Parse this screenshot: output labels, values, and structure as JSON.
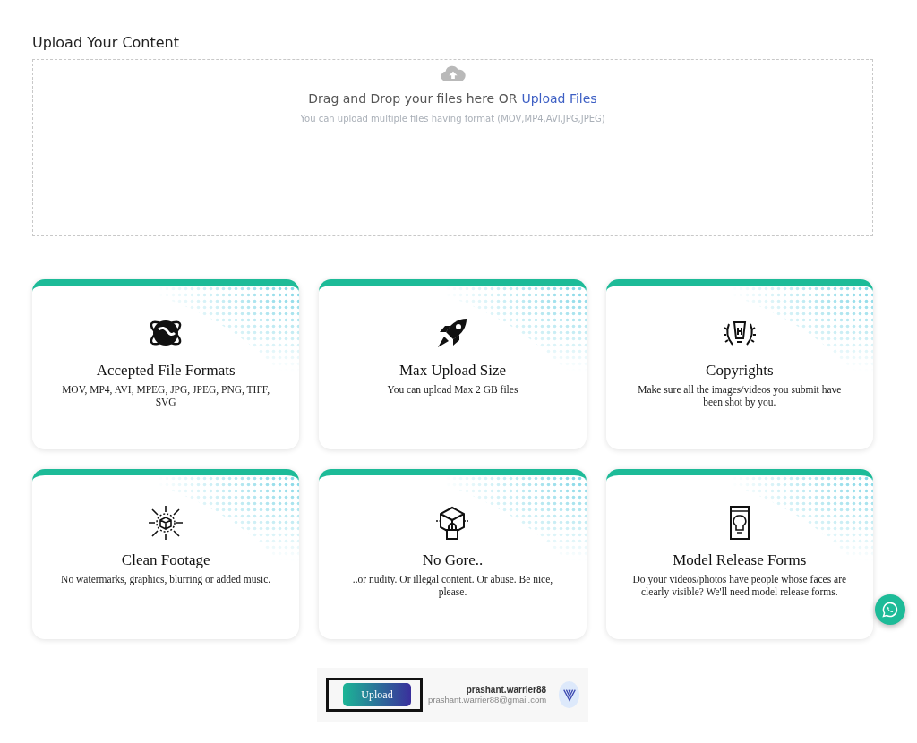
{
  "heading": "Upload Your Content",
  "dropzone": {
    "text": "Drag and Drop your files here OR",
    "link": "Upload Files",
    "hint": "You can upload multiple files having format (MOV,MP4,AVI,JPG,JPEG)"
  },
  "cards": [
    {
      "kind": "globe",
      "title": "Accepted File Formats",
      "text": "MOV, MP4, AVI, MPEG, JPG, JPEG, PNG, TIFF, SVG"
    },
    {
      "kind": "rocket",
      "title": "Max Upload Size",
      "text": "You can upload Max 2 GB files"
    },
    {
      "kind": "pen",
      "title": "Copyrights",
      "text": "Make sure all the images/videos you submit have been shot by you."
    },
    {
      "kind": "cube",
      "title": "Clean Footage",
      "text": "No watermarks, graphics, blurring or added music."
    },
    {
      "kind": "lock",
      "title": "No Gore..",
      "text": "..or nudity. Or illegal content. Or abuse. Be nice, please."
    },
    {
      "kind": "form",
      "title": "Model Release Forms",
      "text": "Do your videos/photos have people whose faces are clearly visible? We'll need model release forms."
    }
  ],
  "footer": {
    "button": "Upload",
    "username": "prashant.warrier88",
    "email": "prashant.warrier88@gmail.com"
  }
}
